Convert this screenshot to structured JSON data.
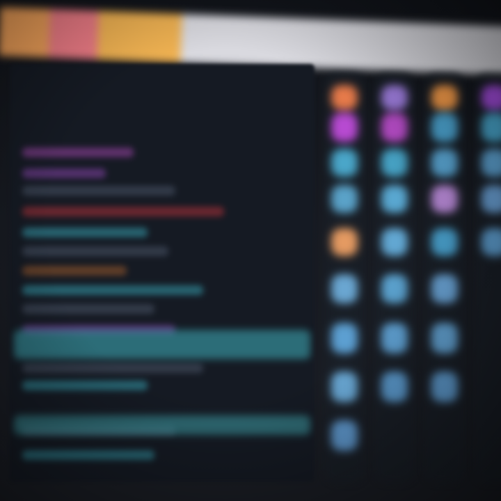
{
  "topbar": {
    "segments": [
      "#f2a25a",
      "#ee7c86",
      "#f0b252"
    ],
    "rest_color": "#d9d9df"
  },
  "editor": {
    "background": "#151a23",
    "line_colors": {
      "pink": "#7a3a86",
      "purple": "#6a3a88",
      "red": "#8a2c34",
      "teal": "#2e7d8c",
      "gray": "#3d4656",
      "orange": "#7a4a2a"
    },
    "highlight_colors": {
      "cyan": "#3a9aa6",
      "teal": "#3a8f98"
    }
  },
  "palettes": [
    {
      "column": 1,
      "swatches": [
        "#e67a4a",
        "#b74ad1",
        "#4aa6c9",
        "#5aa2c8",
        "#e49a62",
        "#6aa6d1",
        "#5c9fd1",
        "#6aa9d6",
        "#5e97cc"
      ]
    },
    {
      "column": 2,
      "swatches": [
        "#9a7ad8",
        "#b24ac2",
        "#46a1c3",
        "#59a7d0",
        "#62a7d2",
        "#5aa0cc",
        "#5e9fd0",
        "#5a98cb"
      ]
    },
    {
      "column": 3,
      "swatches": [
        "#f49a48",
        "#4ba3cf",
        "#59a5d2",
        "#b98ad8",
        "#4aa3d0",
        "#6aa4d6",
        "#62a2d2",
        "#5e9bcf"
      ]
    },
    {
      "column": 4,
      "swatches": [
        "#a54de0",
        "#49a8cf",
        "#5ea4d4",
        "#6aa1d6",
        "#5e9fd1"
      ]
    }
  ]
}
